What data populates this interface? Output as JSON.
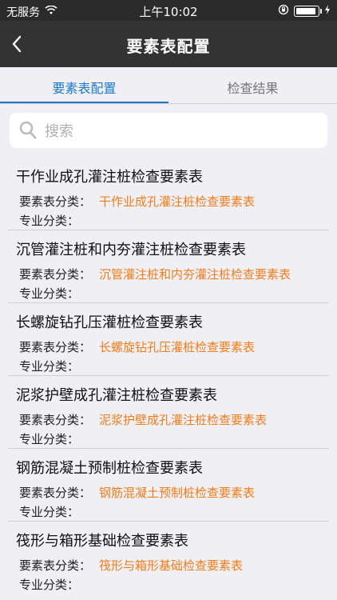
{
  "status_bar": {
    "carrier": "无服务",
    "time": "上午10:02"
  },
  "nav": {
    "title": "要素表配置"
  },
  "tabs": [
    {
      "label": "要素表配置"
    },
    {
      "label": "检查结果"
    }
  ],
  "search": {
    "placeholder": "搜索"
  },
  "labels": {
    "category": "要素表分类：",
    "specialty": "专业分类："
  },
  "items": [
    {
      "title": "干作业成孔灌注桩检查要素表",
      "category": "干作业成孔灌注桩检查要素表"
    },
    {
      "title": "沉管灌注桩和内夯灌注桩检查要素表",
      "category": "沉管灌注桩和内夯灌注桩检查要素表"
    },
    {
      "title": "长螺旋钻孔压灌桩检查要素表",
      "category": "长螺旋钻孔压灌桩检查要素表"
    },
    {
      "title": "泥浆护壁成孔灌注桩检查要素表",
      "category": "泥浆护壁成孔灌注桩检查要素表"
    },
    {
      "title": "钢筋混凝土预制桩检查要素表",
      "category": "钢筋混凝土预制桩检查要素表"
    },
    {
      "title": "筏形与箱形基础检查要素表",
      "category": "筏形与箱形基础检查要素表"
    }
  ],
  "colors": {
    "accent": "#1e78c8",
    "value": "#f07d1a",
    "nav_bg": "#333333"
  },
  "icons": {
    "back": "chevron-left-icon",
    "search": "search-icon",
    "wifi": "wifi-icon",
    "lock": "rotation-lock-icon",
    "battery": "battery-icon",
    "charging": "charging-icon"
  }
}
